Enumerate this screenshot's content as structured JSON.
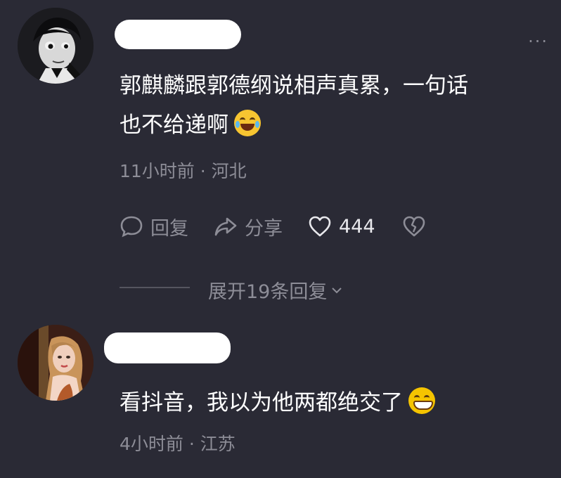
{
  "comments": [
    {
      "text_line1": "郭麒麟跟郭德纲说相声真累，一句话",
      "text_line2": "也不给递啊",
      "meta": "11小时前 · 河北",
      "actions": {
        "reply": "回复",
        "share": "分享",
        "likes": "444"
      },
      "expand_replies": "展开19条回复"
    },
    {
      "text": "看抖音，我以为他两都绝交了",
      "meta": "4小时前 · 江苏"
    }
  ],
  "colors": {
    "background": "#2a2a35",
    "text": "#ffffff",
    "muted": "#8d8d97"
  },
  "icons": [
    "reply-icon",
    "share-icon",
    "heart-icon",
    "broken-heart-icon",
    "chevron-down-icon",
    "laughing-tears-emoji",
    "grin-emoji",
    "more-icon"
  ]
}
